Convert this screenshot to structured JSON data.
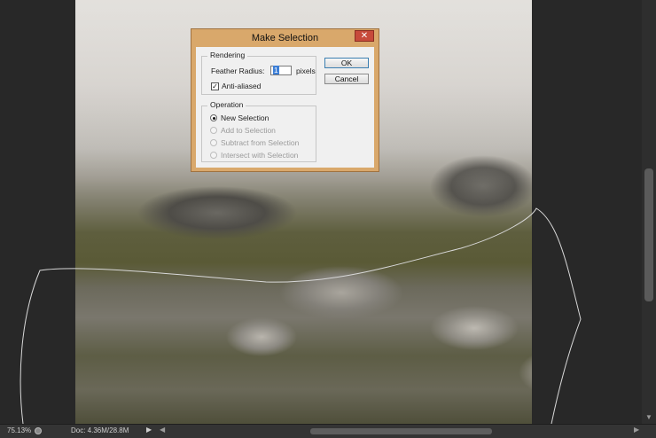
{
  "colors": {
    "workspace": "#282828",
    "dialog_frame": "#d9a86b",
    "close_button": "#c74a3b",
    "dialog_body": "#f0f0f0",
    "selection_highlight": "#3d7fd6"
  },
  "dialog": {
    "title": "Make Selection",
    "close_icon": "close-icon",
    "rendering": {
      "legend": "Rendering",
      "feather_label": "Feather Radius:",
      "feather_value": "1",
      "feather_unit": "pixels",
      "anti_aliased_label": "Anti-aliased",
      "anti_aliased_checked": true
    },
    "operation": {
      "legend": "Operation",
      "options": [
        {
          "label": "New Selection",
          "selected": true,
          "enabled": true
        },
        {
          "label": "Add to Selection",
          "selected": false,
          "enabled": false
        },
        {
          "label": "Subtract from Selection",
          "selected": false,
          "enabled": false
        },
        {
          "label": "Intersect with Selection",
          "selected": false,
          "enabled": false
        }
      ]
    },
    "buttons": {
      "ok": "OK",
      "cancel": "Cancel"
    }
  },
  "status": {
    "zoom": "75.13%",
    "doc": "Doc: 4.36M/28.8M"
  },
  "icons": {
    "proof": "proof-setup-icon",
    "status_menu": "triangle-right-icon",
    "scroll_left": "arrow-left-icon",
    "scroll_right": "arrow-right-icon",
    "scroll_down": "arrow-down-icon"
  }
}
